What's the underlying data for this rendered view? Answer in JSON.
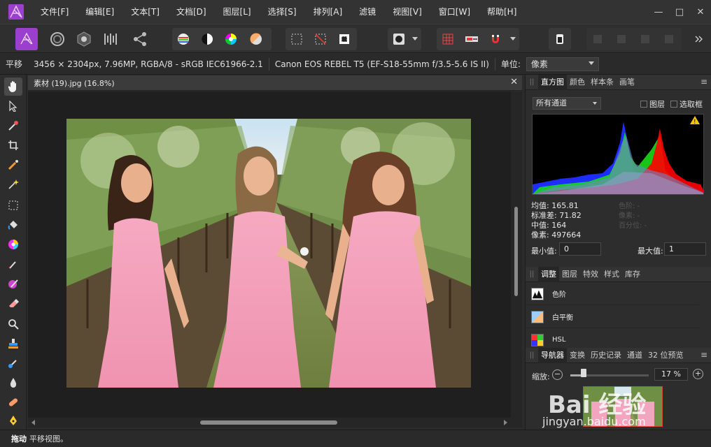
{
  "app": {
    "name": "Affinity Photo"
  },
  "menu": [
    "文件[F]",
    "编辑[E]",
    "文本[T]",
    "文档[D]",
    "图层[L]",
    "选择[S]",
    "排列[A]",
    "滤镜",
    "视图[V]",
    "窗口[W]",
    "帮助[H]"
  ],
  "window_controls": {
    "minimize": "—",
    "maximize": "□",
    "close": "✕"
  },
  "context": {
    "tool": "平移",
    "dimensions": "3456 × 2304px, 7.96MP, RGBA/8 - sRGB IEC61966-2.1",
    "camera": "Canon EOS REBEL T5 (EF-S18-55mm f/3.5-5.6 IS II)",
    "unit_label": "单位:",
    "unit_value": "像素"
  },
  "document": {
    "title": "素材 (19).jpg (16.8%)",
    "close": "✕"
  },
  "panels": {
    "top_tabs": [
      "直方图",
      "颜色",
      "样本条",
      "画笔"
    ],
    "histogram": {
      "channel": "所有通道",
      "layer_label": "图层",
      "marquee_label": "选取框",
      "warning": "!",
      "mean": "均值: 165.81",
      "std": "标准差: 71.82",
      "median": "中值: 164",
      "pixels": "像素: 497664",
      "color_label": "色阶: -",
      "pixel_label": "像素: -",
      "percentile_label": "百分位: -",
      "min_label": "最小值:",
      "min_value": "0",
      "max_label": "最大值:",
      "max_value": "1"
    },
    "mid_tabs": [
      "调整",
      "图层",
      "特效",
      "样式",
      "库存"
    ],
    "adjustments": [
      "色阶",
      "白平衡",
      "HSL"
    ],
    "bottom_tabs": [
      "导航器",
      "变换",
      "历史记录",
      "通道",
      "32 位预览"
    ],
    "navigator": {
      "zoom_label": "缩放:",
      "zoom_value": "17 %",
      "zoom_fraction": 0.17,
      "minus": "−",
      "plus": "+"
    }
  },
  "status": {
    "action": "拖动",
    "message": "平移视图。"
  },
  "watermark": {
    "logo": "Bai 经验",
    "url": "jingyan.baidu.com"
  },
  "colors": {
    "accent": "#9b3fcf",
    "menubar": "#333333",
    "canvas": "#1f1f1f"
  }
}
